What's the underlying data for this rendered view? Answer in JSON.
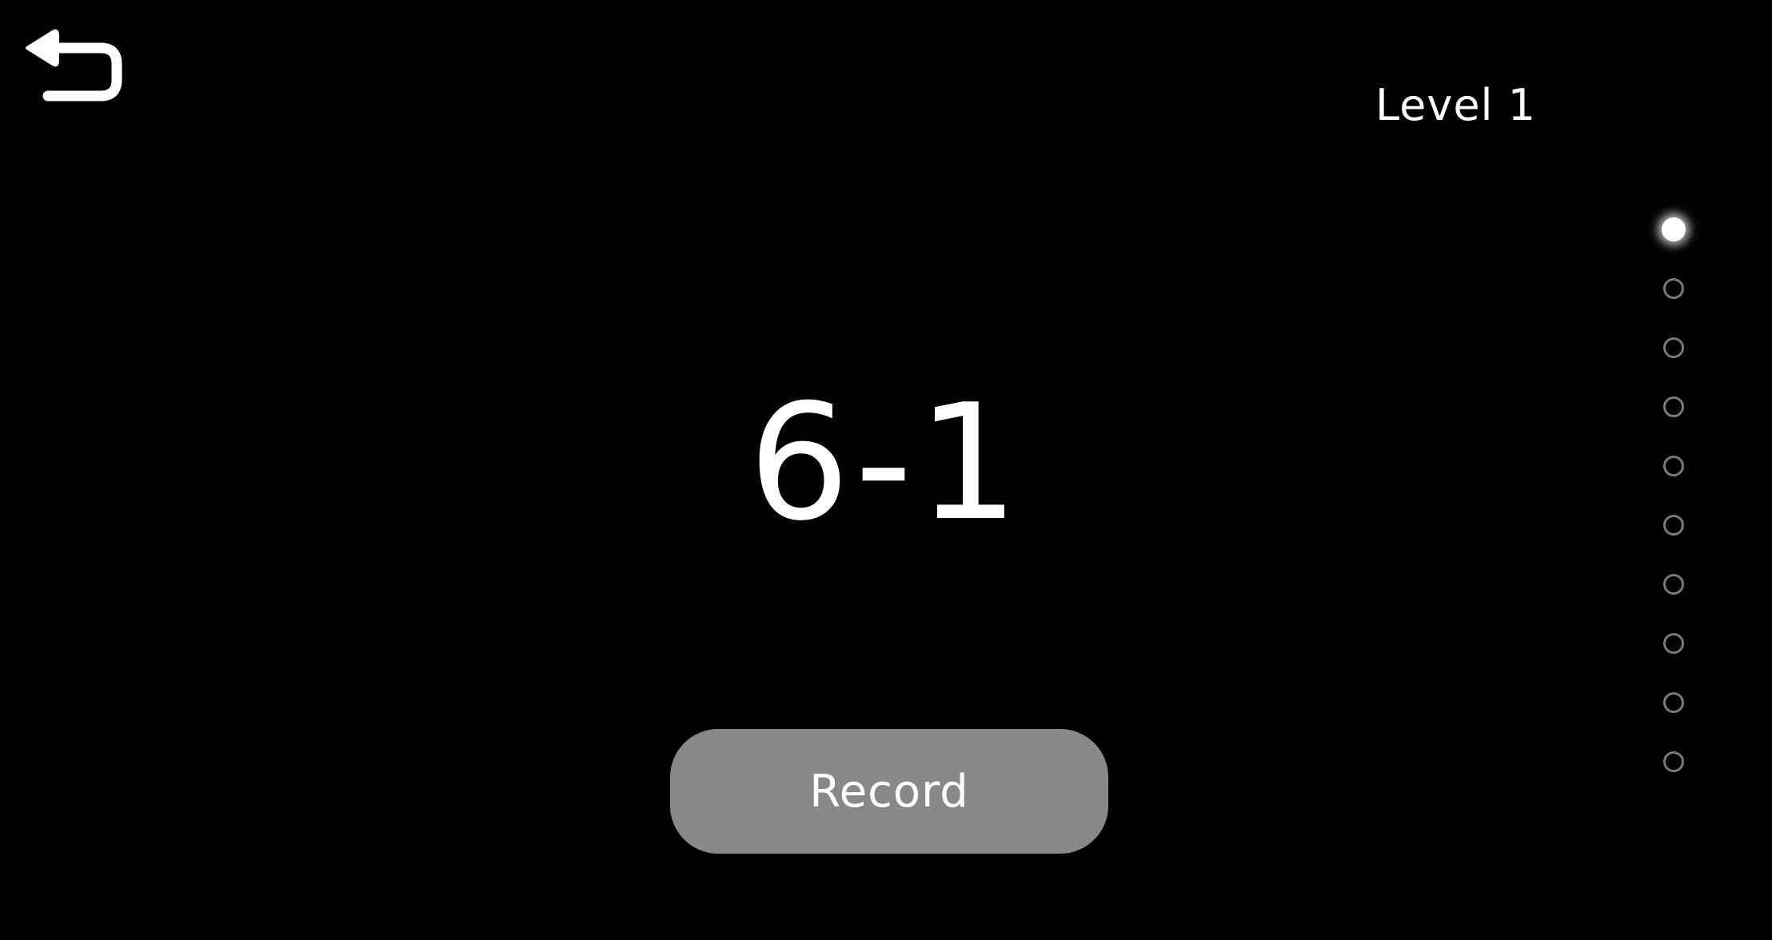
{
  "header": {
    "back_icon": "back-arrow-icon",
    "level_label": "Level 1"
  },
  "question": {
    "expression": "6-1"
  },
  "controls": {
    "record_label": "Record",
    "record_color": "#888888"
  },
  "progress": {
    "total": 10,
    "current": 1,
    "active_color": "#ffffff",
    "inactive_color": "#7a7a7a"
  },
  "colors": {
    "background": "#000000",
    "text": "#ffffff"
  }
}
